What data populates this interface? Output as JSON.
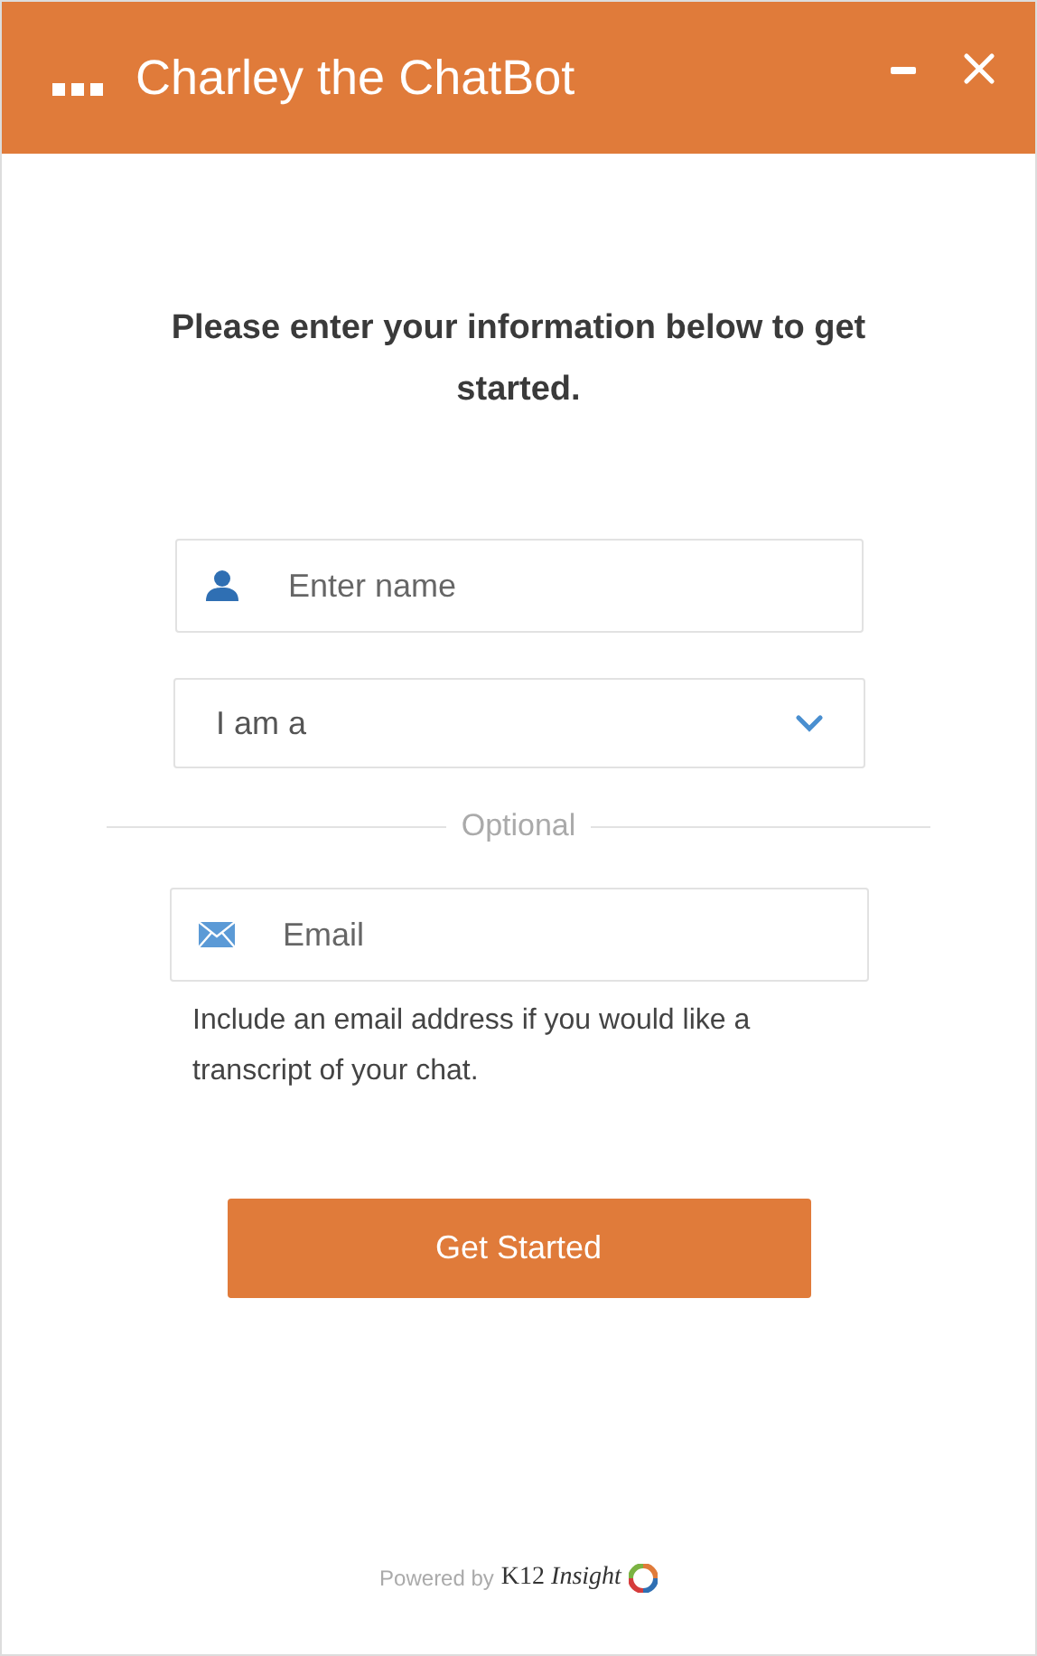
{
  "window": {
    "title": "Charley the ChatBot"
  },
  "heading": "Please enter your information below to get started.",
  "name_field": {
    "placeholder": "Enter name"
  },
  "role_select": {
    "value": "I am a"
  },
  "divider_label": "Optional",
  "email_field": {
    "placeholder": "Email"
  },
  "email_help": "Include an email address if you would like a transcript of your chat.",
  "submit_button": "Get Started",
  "footer": {
    "powered_by": "Powered by",
    "brand": "K12 *Insight*"
  }
}
